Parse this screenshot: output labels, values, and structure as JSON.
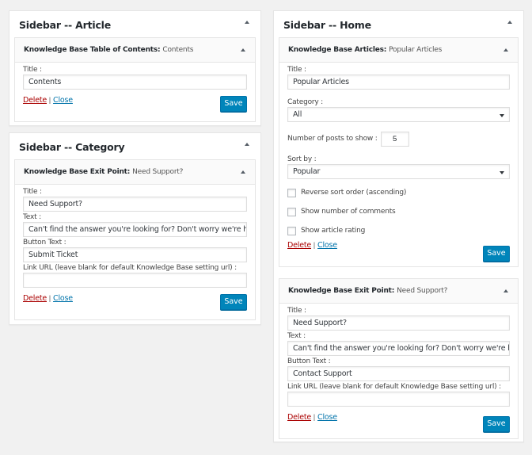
{
  "sidebars": {
    "article": {
      "title": "Sidebar -- Article",
      "widget": {
        "type_label": "Knowledge Base Table of Contents:",
        "instance_title": "Contents",
        "title_label": "Title :",
        "title_value": "Contents",
        "delete_label": "Delete",
        "separator": "|",
        "close_label": "Close",
        "save_label": "Save"
      }
    },
    "category": {
      "title": "Sidebar -- Category",
      "widget": {
        "type_label": "Knowledge Base Exit Point:",
        "instance_title": "Need Support?",
        "title_label": "Title :",
        "title_value": "Need Support?",
        "text_label": "Text :",
        "text_value": "Can't find the answer you're looking for? Don't worry we're her",
        "button_text_label": "Button Text :",
        "button_text_value": "Submit Ticket",
        "link_url_label": "Link URL (leave blank for default Knowledge Base setting url) :",
        "link_url_value": "",
        "delete_label": "Delete",
        "separator": "|",
        "close_label": "Close",
        "save_label": "Save"
      }
    },
    "home": {
      "title": "Sidebar -- Home",
      "articles_widget": {
        "type_label": "Knowledge Base Articles:",
        "instance_title": "Popular Articles",
        "title_label": "Title :",
        "title_value": "Popular Articles",
        "category_label": "Category :",
        "category_value": "All",
        "posts_label": "Number of posts to show :",
        "posts_value": "5",
        "sort_label": "Sort by :",
        "sort_value": "Popular",
        "checkboxes": [
          {
            "label": "Reverse sort order (ascending)",
            "checked": false
          },
          {
            "label": "Show number of comments",
            "checked": false
          },
          {
            "label": "Show article rating",
            "checked": false
          }
        ],
        "delete_label": "Delete",
        "separator": "|",
        "close_label": "Close",
        "save_label": "Save"
      },
      "exit_widget": {
        "type_label": "Knowledge Base Exit Point:",
        "instance_title": "Need Support?",
        "title_label": "Title :",
        "title_value": "Need Support?",
        "text_label": "Text :",
        "text_value": "Can't find the answer you're looking for? Don't worry we're her",
        "button_text_label": "Button Text :",
        "button_text_value": "Contact Support",
        "link_url_label": "Link URL (leave blank for default Knowledge Base setting url) :",
        "link_url_value": "",
        "delete_label": "Delete",
        "separator": "|",
        "close_label": "Close",
        "save_label": "Save"
      }
    }
  },
  "colors": {
    "primary_button": "#0085ba",
    "delete_link": "#aa0000",
    "close_link": "#0073aa",
    "page_background": "#f1f1f1"
  }
}
